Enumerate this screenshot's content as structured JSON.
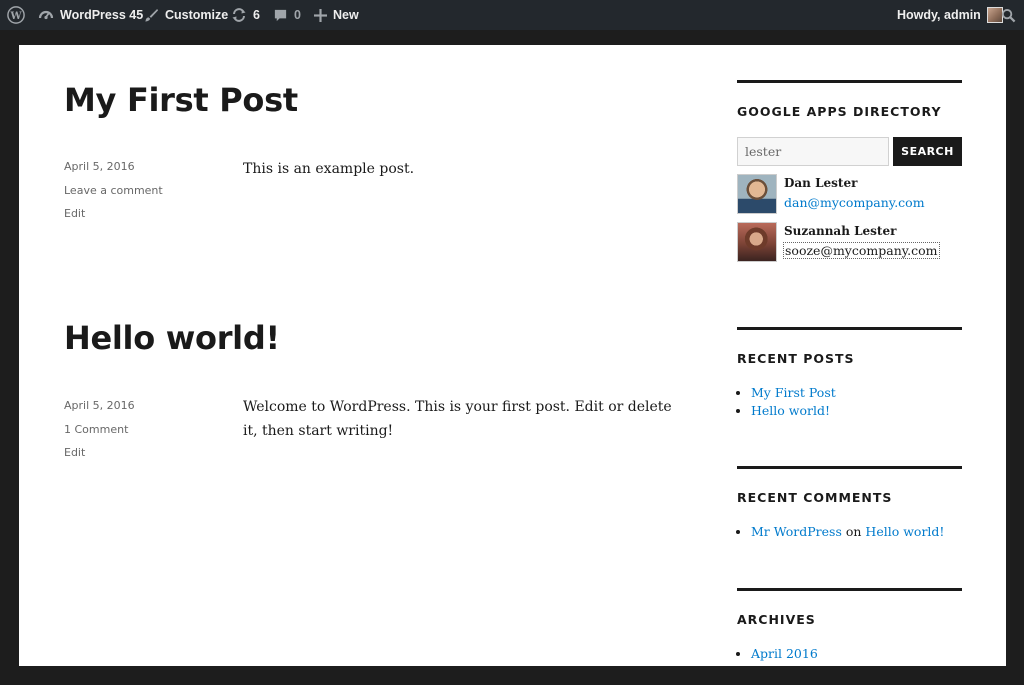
{
  "adminbar": {
    "site_name": "WordPress 45",
    "customize": "Customize",
    "updates_count": "6",
    "comments_count": "0",
    "new_label": "New",
    "greeting": "Howdy, admin"
  },
  "posts": [
    {
      "title": "My First Post",
      "date": "April 5, 2016",
      "comments": "Leave a comment",
      "edit": "Edit",
      "body": "This is an example post."
    },
    {
      "title": "Hello world!",
      "date": "April 5, 2016",
      "comments": "1 Comment",
      "edit": "Edit",
      "body": "Welcome to WordPress. This is your first post. Edit or delete it, then start writing!"
    }
  ],
  "sidebar": {
    "directory": {
      "title": "GOOGLE APPS DIRECTORY",
      "search_value": "lester",
      "search_button": "SEARCH",
      "results": [
        {
          "name": "Dan Lester",
          "email": "dan@mycompany.com"
        },
        {
          "name": "Suzannah Lester",
          "email": "sooze@mycompany.com"
        }
      ]
    },
    "recent_posts": {
      "title": "RECENT POSTS",
      "items": [
        "My First Post",
        "Hello world!"
      ]
    },
    "recent_comments": {
      "title": "RECENT COMMENTS",
      "author": "Mr WordPress",
      "on": "on",
      "post": "Hello world!"
    },
    "archives": {
      "title": "ARCHIVES",
      "items": [
        "April 2016"
      ]
    }
  }
}
